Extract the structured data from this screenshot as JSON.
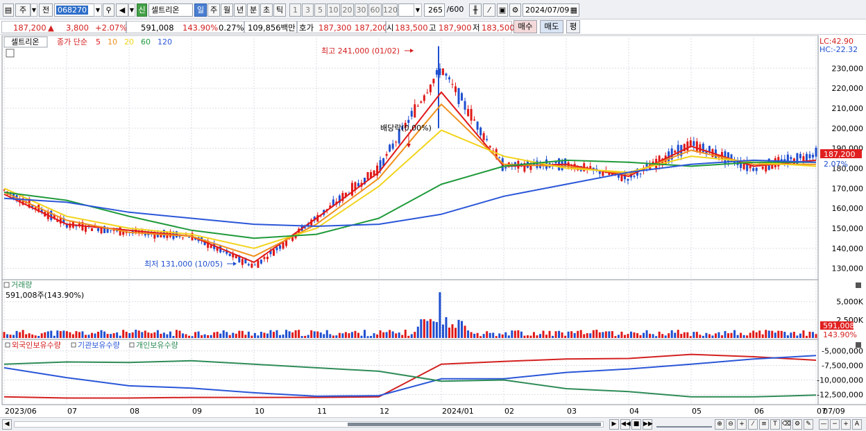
{
  "toolbar": {
    "period_label": "주",
    "prev_label": "전",
    "code": "068270",
    "new_badge": "신",
    "stock_name": "셀트리온",
    "periods": [
      "일",
      "주",
      "월",
      "년",
      "분",
      "초",
      "틱"
    ],
    "active_period": "일",
    "intervals": [
      "1",
      "3",
      "5",
      "10",
      "20",
      "30",
      "60",
      "120"
    ],
    "count": "265",
    "count_max": "/600",
    "date": "2024/07/09"
  },
  "quote": {
    "price": "187,200",
    "arrow": "▲",
    "change": "3,800",
    "change_pct": "+2.07%",
    "volume": "591,008",
    "volume_ratio": "143.90%",
    "turnover": "0.27%",
    "amount": "109,856백만",
    "hoga_label": "호가",
    "ask": "187,300",
    "bid": "187,200",
    "open_label": "시",
    "open": "183,500",
    "high_label": "고",
    "high": "187,900",
    "low_label": "저",
    "low": "183,500",
    "buy_label": "매수",
    "sell_label": "매도",
    "eval_label": "평"
  },
  "price_panel": {
    "stock_label": "셀트리온",
    "ma_title": "종가 단순",
    "ma_periods": [
      "5",
      "10",
      "20",
      "60",
      "120"
    ],
    "ma_colors": [
      "#e01818",
      "#f0901c",
      "#f2d41c",
      "#1f9a3a",
      "#2a56d8"
    ],
    "lc": "LC:42.90",
    "hc": "HC:-22.32",
    "y_ticks": [
      "230,000",
      "220,000",
      "210,000",
      "200,000",
      "190,000",
      "180,000",
      "170,000",
      "160,000",
      "150,000",
      "140,000",
      "130,000"
    ],
    "current_price": "187,200",
    "current_pct": "2.07%",
    "annotation_high": "최고 241,000 (01/02)",
    "annotation_low": "최저 131,000 (10/05)",
    "annotation_dividend": "배당락(0.00%)"
  },
  "volume_panel": {
    "title": "거래량",
    "info": "591,008주(143.90%)",
    "y_ticks": [
      "5,000K",
      "2,500K"
    ],
    "current": "591,008",
    "current_pct": "143.90%"
  },
  "holdings_panel": {
    "legend": [
      "외국인보유수량",
      "기관보유수량",
      "개인보유수량"
    ],
    "legend_colors": [
      "#d42020",
      "#2a56d8",
      "#2e8b57"
    ],
    "y_ticks": [
      "-5,000,000",
      "-7,500,000",
      "-10,000,000",
      "-12,500,000"
    ]
  },
  "x_axis": {
    "labels": [
      "2023/06",
      "07",
      "08",
      "09",
      "10",
      "11",
      "12",
      "2024/01",
      "02",
      "03",
      "04",
      "05",
      "06",
      "07"
    ],
    "right_label": "07/09"
  },
  "chart_data": {
    "type": "candlestick",
    "title": "셀트리온",
    "x_range": [
      "2023/06",
      "2024/07/09"
    ],
    "ylim": [
      125000,
      245000
    ],
    "price_points": [
      {
        "date": "2023/06",
        "close": 169000
      },
      {
        "date": "2023/07",
        "close": 152000
      },
      {
        "date": "2023/08",
        "close": 148000
      },
      {
        "date": "2023/09",
        "close": 146000
      },
      {
        "date": "2023/10/05",
        "close": 131000
      },
      {
        "date": "2023/11",
        "close": 155000
      },
      {
        "date": "2023/12",
        "close": 180000
      },
      {
        "date": "2024/01/02",
        "close": 230000
      },
      {
        "date": "2024/02",
        "close": 181000
      },
      {
        "date": "2024/03",
        "close": 182000
      },
      {
        "date": "2024/04",
        "close": 175000
      },
      {
        "date": "2024/05",
        "close": 192000
      },
      {
        "date": "2024/06",
        "close": 180000
      },
      {
        "date": "2024/07/09",
        "close": 187200
      }
    ],
    "high": {
      "date": "01/02",
      "value": 241000
    },
    "low": {
      "date": "10/05",
      "value": 131000
    },
    "series": [
      {
        "name": "5",
        "values": [
          167000,
          152000,
          149000,
          146000,
          133000,
          155000,
          178000,
          218000,
          181000,
          182000,
          176000,
          191000,
          181000,
          184000
        ]
      },
      {
        "name": "10",
        "values": [
          168000,
          154000,
          148000,
          146000,
          136000,
          152000,
          175000,
          212000,
          182000,
          181000,
          177000,
          189000,
          182000,
          182000
        ]
      },
      {
        "name": "20",
        "values": [
          170000,
          156000,
          150000,
          147000,
          140000,
          150000,
          171000,
          199000,
          186000,
          180000,
          178000,
          186000,
          183000,
          181000
        ]
      },
      {
        "name": "60",
        "values": [
          168000,
          164000,
          156000,
          149000,
          145000,
          147000,
          155000,
          172000,
          181000,
          184000,
          183000,
          181000,
          183000,
          183000
        ]
      },
      {
        "name": "120",
        "values": [
          165000,
          163000,
          158000,
          155000,
          152000,
          151000,
          152000,
          157000,
          166000,
          172000,
          178000,
          182000,
          184000,
          183000
        ]
      }
    ],
    "volume": {
      "current": 591008,
      "max_spike": {
        "date": "2024/01/02",
        "value": 6300000
      },
      "ylim": [
        0,
        6500000
      ]
    },
    "holdings": {
      "ylim": [
        -14000000,
        -3500000
      ],
      "series": [
        {
          "name": "외국인보유수량",
          "values": [
            -12900000,
            -13100000,
            -13100000,
            -13000000,
            -13000000,
            -13000000,
            -12900000,
            -7300000,
            -6800000,
            -6400000,
            -6300000,
            -5600000,
            -6000000,
            -6600000
          ]
        },
        {
          "name": "기관보유수량",
          "values": [
            -7900000,
            -9600000,
            -11000000,
            -11400000,
            -12200000,
            -12800000,
            -12700000,
            -9800000,
            -9800000,
            -8700000,
            -8100000,
            -7300000,
            -6400000,
            -5800000
          ]
        },
        {
          "name": "개인보유수량",
          "values": [
            -7300000,
            -6900000,
            -7000000,
            -6700000,
            -7300000,
            -7900000,
            -8500000,
            -10200000,
            -10000000,
            -11500000,
            -12000000,
            -12900000,
            -12900000,
            -12600000
          ]
        }
      ]
    }
  }
}
